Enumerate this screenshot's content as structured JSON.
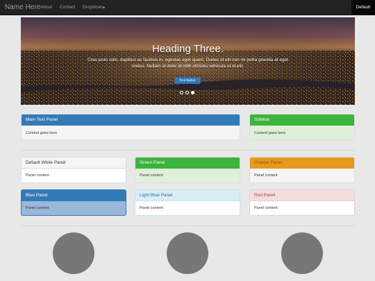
{
  "navbar": {
    "brand": "Name Here",
    "links": [
      "About",
      "Contact",
      "Dropdown"
    ],
    "dropdown_caret": "▾",
    "right": "Default"
  },
  "carousel": {
    "heading": "Heading Three.",
    "text": "Cras justo odio, dapibus ac facilisis in, egestas eget quam. Donec id elit non mi porta gravida at eget metus. Nullam id dolor id nibh ultricies vehicula ut id elit.",
    "button": "Find Button",
    "slide_count": 3,
    "active_slide": 3
  },
  "top_panels": [
    {
      "title": "Main Text Panel",
      "body": "Content goes here"
    },
    {
      "title": "Sidebar",
      "body": "Content goes here"
    }
  ],
  "panels": [
    {
      "title": "Default White Panel",
      "body": "Panel content"
    },
    {
      "title": "Green Panel",
      "body": "Panel content"
    },
    {
      "title": "Orange Panel",
      "body": "Panel content"
    },
    {
      "title": "Blue Panel",
      "body": "Panel content"
    },
    {
      "title": "Light Blue Panel",
      "body": "Panel content"
    },
    {
      "title": "Red Panel",
      "body": "Panel content"
    }
  ],
  "colors": {
    "blue": "#337ab7",
    "green": "#3cb33c",
    "orange": "#e8981c",
    "light_blue": "#d9edf7",
    "red_light": "#f2dede",
    "green_light": "#dff0d8"
  }
}
